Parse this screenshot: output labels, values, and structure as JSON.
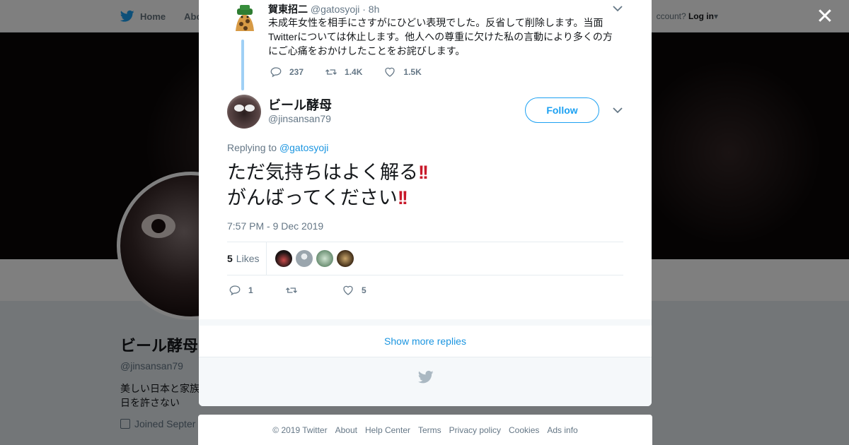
{
  "background": {
    "nav": {
      "home": "Home",
      "about": "Abo"
    },
    "login_prompt": "ccount?",
    "login_link": "Log in",
    "profile": {
      "name": "ビール酵母",
      "handle": "@jinsansan79",
      "bio": "美しい日本と家族 日を許さない",
      "joined": "Joined Septer"
    }
  },
  "parent_tweet": {
    "name": "賀東招二",
    "handle": "@gatosyoji",
    "time": "· 8h",
    "text": "未成年女性を相手にさすがにひどい表現でした。反省して削除します。当面Twitterについては休止します。他人への尊重に欠けた私の言動により多くの方にご心痛をおかけしたことをお詫びします。",
    "replies": "237",
    "retweets": "1.4K",
    "likes": "1.5K"
  },
  "main_tweet": {
    "name": "ビール酵母",
    "handle": "@jinsansan79",
    "follow_label": "Follow",
    "replying_to_label": "Replying to",
    "replying_to_handle": "@gatosyoji",
    "line1": "ただ気持ちはよく解る",
    "line2": "がんばってください",
    "emphasis": "!!",
    "date": "7:57 PM - 9 Dec 2019",
    "likes_count": "5",
    "likes_label": "Likes",
    "replies": "1",
    "retweets": "",
    "likes": "5"
  },
  "show_more": "Show more replies",
  "footer": [
    "© 2019 Twitter",
    "About",
    "Help Center",
    "Terms",
    "Privacy policy",
    "Cookies",
    "Ads info"
  ],
  "colors": {
    "accent": "#1da1f2",
    "link": "#1b95e0",
    "thread": "#9fd0f5",
    "emphasis": "#c8192a"
  },
  "icons": [
    "twitter-bird-icon",
    "close-icon",
    "chevron-down-icon",
    "reply-icon",
    "retweet-icon",
    "heart-icon",
    "calendar-icon"
  ]
}
